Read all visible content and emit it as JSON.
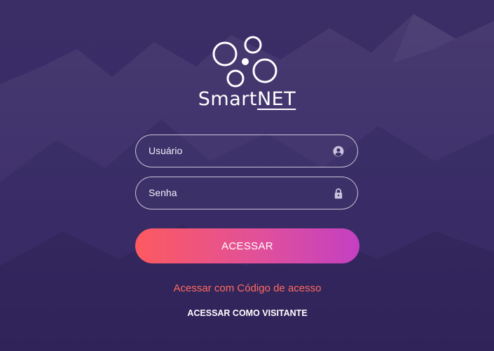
{
  "logo": {
    "text_prefix": "Smart",
    "text_highlight": "NET"
  },
  "form": {
    "username": {
      "placeholder": "Usuário",
      "value": "",
      "icon": "user-circle-icon"
    },
    "password": {
      "placeholder": "Senha",
      "value": "",
      "icon": "lock-icon"
    },
    "submit_label": "ACESSAR"
  },
  "links": {
    "access_code": "Acessar com Código de acesso",
    "visitor": "ACESSAR COMO VISITANTE"
  },
  "colors": {
    "background": "#3a2c68",
    "button_gradient_start": "#fc5a5f",
    "button_gradient_end": "#c340c2",
    "link_accent": "#ff6a5c"
  }
}
